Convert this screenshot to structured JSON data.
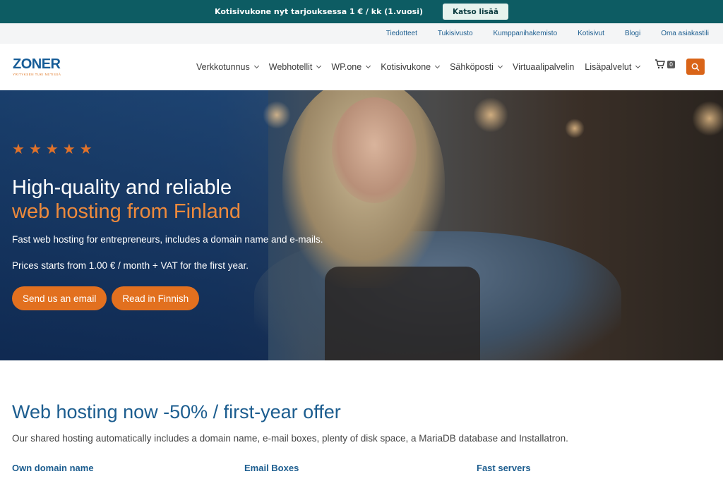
{
  "promo": {
    "text": "Kotisivukone nyt tarjouksessa 1 € / kk (1.vuosi)",
    "button": "Katso lisää"
  },
  "utility_nav": {
    "items": [
      "Tiedotteet",
      "Tukisivusto",
      "Kumppanihakemisto",
      "Kotisivut",
      "Blogi",
      "Oma asiakastili"
    ]
  },
  "header": {
    "logo_word": "ZONER",
    "logo_tagline": "YRITYKSEN TUKI NETISSÄ",
    "menu": [
      {
        "label": "Verkkotunnus",
        "dropdown": true
      },
      {
        "label": "Webhotellit",
        "dropdown": true
      },
      {
        "label": "WP.one",
        "dropdown": true
      },
      {
        "label": "Kotisivukone",
        "dropdown": true
      },
      {
        "label": "Sähköposti",
        "dropdown": true
      },
      {
        "label": "Virtuaalipalvelin",
        "dropdown": false
      },
      {
        "label": "Lisäpalvelut",
        "dropdown": true
      }
    ],
    "cart_count": "0",
    "accent": "#d96418"
  },
  "hero": {
    "rating_stars": 5,
    "title_line1": "High-quality and reliable",
    "title_line2": "web hosting from Finland",
    "subtitle": "Fast web hosting for entrepreneurs, includes a domain name and e-mails.",
    "price_line": "Prices starts from 1.00 € / month + VAT for the first year.",
    "cta_primary": "Send us an email",
    "cta_secondary": "Read in Finnish"
  },
  "offer": {
    "title": "Web hosting now -50% / first-year offer",
    "description": "Our shared hosting automatically includes a domain name, e-mail boxes, plenty of disk space, a MariaDB database and Installatron.",
    "features": [
      "Own domain name",
      "Email Boxes",
      "Fast servers"
    ]
  },
  "colors": {
    "brand_blue": "#165c97",
    "brand_orange": "#e2701f",
    "promo_bg": "#0d5c63"
  }
}
